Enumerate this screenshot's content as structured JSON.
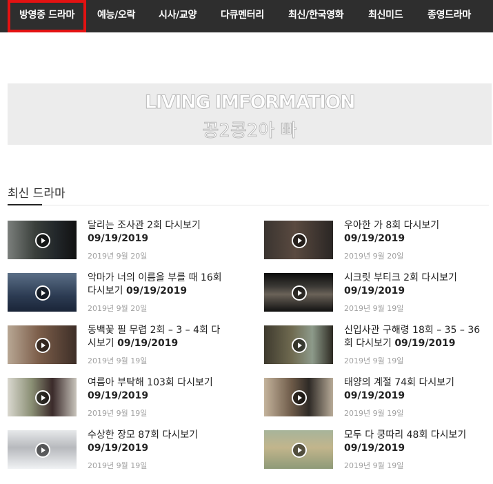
{
  "nav": {
    "items": [
      {
        "label": "방영중 드라마",
        "active": true
      },
      {
        "label": "예능/오락"
      },
      {
        "label": "시사/교양"
      },
      {
        "label": "다큐멘터리"
      },
      {
        "label": "최신/한국영화"
      },
      {
        "label": "최신미드"
      },
      {
        "label": "종영드라마"
      }
    ]
  },
  "banner": {
    "line1": "LIVING IMFORMATION",
    "line2": "꽁2콩2아 빠"
  },
  "section": {
    "title": "최신 드라마"
  },
  "posts": [
    {
      "title": "달리는 조사관 2회 다시보기",
      "title_date": "09/19/2019",
      "date": "2019년 9월 20일"
    },
    {
      "title": "우아한 가 8회 다시보기",
      "title_date": "09/19/2019",
      "date": "2019년 9월 20일"
    },
    {
      "title": "악마가 너의 이름을 부를 때 16회 다시보기",
      "title_date": "09/19/2019",
      "date": "2019년 9월 20일"
    },
    {
      "title": "시크릿 부티크 2회 다시보기",
      "title_date": "09/19/2019",
      "date": "2019년 9월 19일"
    },
    {
      "title": "동백꽃 필 무렵 2회 – 3 – 4회 다시보기",
      "title_date": "09/19/2019",
      "date": "2019년 9월 19일"
    },
    {
      "title": "신입사관 구해령 18회 – 35 – 36회 다시보기",
      "title_date": "09/19/2019",
      "date": "2019년 9월 19일"
    },
    {
      "title": "여름아 부탁해 103회 다시보기",
      "title_date": "09/19/2019",
      "date": "2019년 9월 19일"
    },
    {
      "title": "태양의 계절 74회 다시보기",
      "title_date": "09/19/2019",
      "date": "2019년 9월 19일"
    },
    {
      "title": "수상한 장모 87회 다시보기",
      "title_date": "09/19/2019",
      "date": "2019년 9월 19일"
    },
    {
      "title": "모두 다 쿵따리 48회 다시보기",
      "title_date": "09/19/2019",
      "date": "2019년 9월 19일"
    }
  ]
}
